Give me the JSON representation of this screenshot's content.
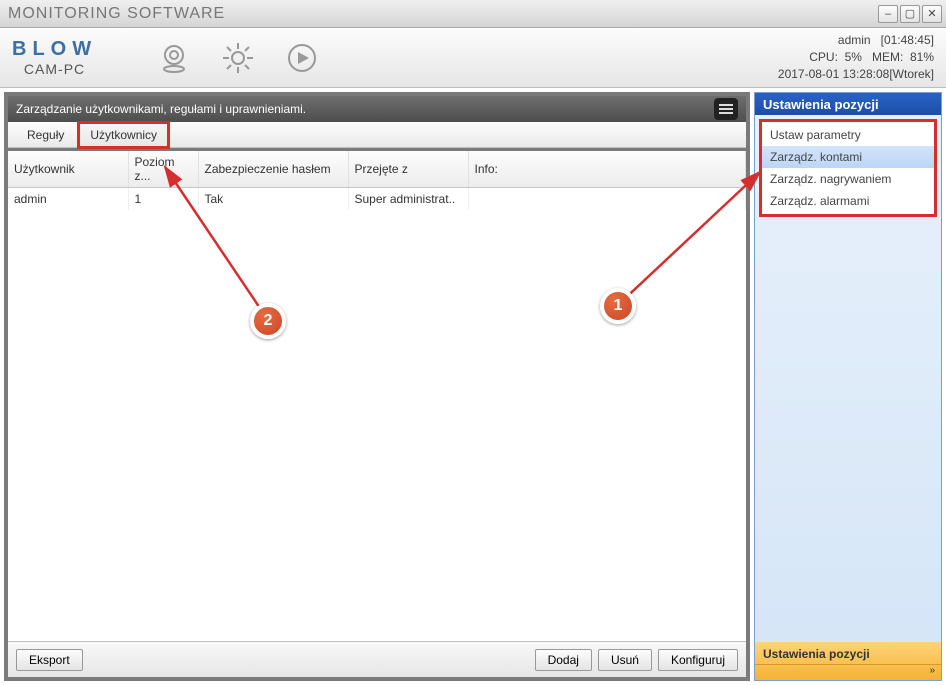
{
  "titlebar": {
    "title": "MONITORING SOFTWARE"
  },
  "header": {
    "logo": "BLOW",
    "logo_sub": "CAM-PC",
    "icons": {
      "camera": "camera-icon",
      "gear": "gear-icon",
      "play": "play-icon"
    },
    "status": {
      "user": "admin",
      "uptime": "[01:48:45]",
      "cpu_label": "CPU:",
      "cpu_value": "5%",
      "mem_label": "MEM:",
      "mem_value": "81%",
      "datetime": "2017-08-01 13:28:08[Wtorek]"
    }
  },
  "pane": {
    "title": "Zarządzanie użytkownikami, regułami i uprawnieniami."
  },
  "tabs": {
    "rules": "Reguły",
    "users": "Użytkownicy"
  },
  "table": {
    "columns": {
      "user": "Użytkownik",
      "level": "Poziom z...",
      "pwprotect": "Zabezpieczenie hasłem",
      "accepted_from": "Przejęte z",
      "info": "Info:"
    },
    "rows": [
      {
        "user": "admin",
        "level": "1",
        "pwprotect": "Tak",
        "accepted_from": "Super administrat..",
        "info": ""
      }
    ]
  },
  "footer": {
    "export": "Eksport",
    "add": "Dodaj",
    "remove": "Usuń",
    "configure": "Konfiguruj"
  },
  "right": {
    "title": "Ustawienia pozycji",
    "items": {
      "params": "Ustaw parametry",
      "accounts": "Zarządz. kontami",
      "recording": "Zarządz. nagrywaniem",
      "alarms": "Zarządz. alarmami"
    },
    "footer_label": "Ustawienia pozycji"
  },
  "annotations": {
    "b1": "1",
    "b2": "2"
  }
}
